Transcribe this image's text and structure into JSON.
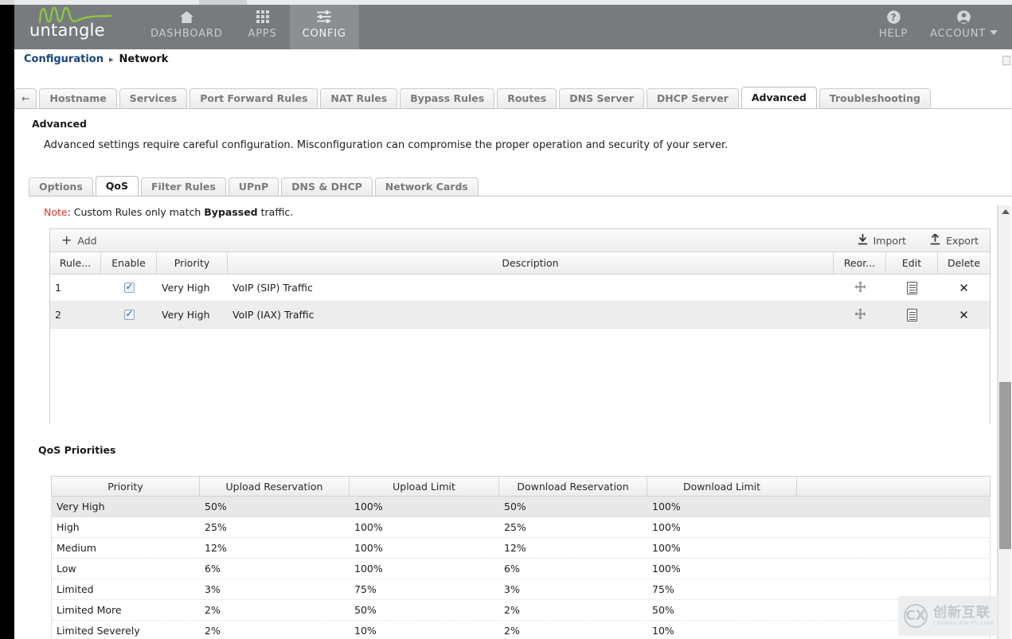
{
  "header": {
    "brand": "untangle",
    "nav": [
      {
        "label": "DASHBOARD",
        "icon": "home-icon",
        "active": false
      },
      {
        "label": "APPS",
        "icon": "grid-apps-icon",
        "active": false
      },
      {
        "label": "CONFIG",
        "icon": "sliders-icon",
        "active": true
      }
    ],
    "nav_right": [
      {
        "label": "HELP",
        "icon": "question-circle-icon"
      },
      {
        "label": "ACCOUNT",
        "icon": "user-circle-icon",
        "caret": "chevron-down-icon"
      }
    ]
  },
  "breadcrumb": {
    "root": "Configuration",
    "separator": "▸",
    "current": "Network"
  },
  "main_tabs": {
    "back_arrow": "←",
    "items": [
      {
        "label": "Hostname",
        "active": false
      },
      {
        "label": "Services",
        "active": false
      },
      {
        "label": "Port Forward Rules",
        "active": false
      },
      {
        "label": "NAT Rules",
        "active": false
      },
      {
        "label": "Bypass Rules",
        "active": false
      },
      {
        "label": "Routes",
        "active": false
      },
      {
        "label": "DNS Server",
        "active": false
      },
      {
        "label": "DHCP Server",
        "active": false
      },
      {
        "label": "Advanced",
        "active": true
      },
      {
        "label": "Troubleshooting",
        "active": false
      }
    ]
  },
  "section": {
    "title": "Advanced",
    "description": "Advanced settings require careful configuration. Misconfiguration can compromise the proper operation and security of your server."
  },
  "sub_tabs": {
    "items": [
      {
        "label": "Options",
        "active": false
      },
      {
        "label": "QoS",
        "active": true
      },
      {
        "label": "Filter Rules",
        "active": false
      },
      {
        "label": "UPnP",
        "active": false
      },
      {
        "label": "DNS & DHCP",
        "active": false
      },
      {
        "label": "Network Cards",
        "active": false
      }
    ]
  },
  "note": {
    "keyword": "Note",
    "text_before": ": Custom Rules only match ",
    "emphasis": "Bypassed",
    "text_after": " traffic."
  },
  "rules_grid": {
    "toolbar": {
      "add_label": "Add",
      "add_icon": "plus-icon",
      "import_label": "Import",
      "import_icon": "download-arrow-icon",
      "export_label": "Export",
      "export_icon": "upload-arrow-icon"
    },
    "columns": [
      "Rule...",
      "Enable",
      "Priority",
      "Description",
      "Reor...",
      "Edit",
      "Delete"
    ],
    "rows": [
      {
        "rule_id": "1",
        "enabled": true,
        "priority": "Very High",
        "description": "VoIP (SIP) Traffic",
        "reorder_icon": "move-handle-icon",
        "edit_icon": "document-edit-icon",
        "delete_icon": "close-x-icon"
      },
      {
        "rule_id": "2",
        "enabled": true,
        "priority": "Very High",
        "description": "VoIP (IAX) Traffic",
        "reorder_icon": "move-handle-icon",
        "edit_icon": "document-edit-icon",
        "delete_icon": "close-x-icon"
      }
    ]
  },
  "qos_priorities": {
    "title": "QoS Priorities",
    "columns": [
      "Priority",
      "Upload Reservation",
      "Upload Limit",
      "Download Reservation",
      "Download Limit"
    ],
    "rows": [
      {
        "priority": "Very High",
        "upload_reservation": "50%",
        "upload_limit": "100%",
        "download_reservation": "50%",
        "download_limit": "100%"
      },
      {
        "priority": "High",
        "upload_reservation": "25%",
        "upload_limit": "100%",
        "download_reservation": "25%",
        "download_limit": "100%"
      },
      {
        "priority": "Medium",
        "upload_reservation": "12%",
        "upload_limit": "100%",
        "download_reservation": "12%",
        "download_limit": "100%"
      },
      {
        "priority": "Low",
        "upload_reservation": "6%",
        "upload_limit": "100%",
        "download_reservation": "6%",
        "download_limit": "100%"
      },
      {
        "priority": "Limited",
        "upload_reservation": "3%",
        "upload_limit": "75%",
        "download_reservation": "3%",
        "download_limit": "75%"
      },
      {
        "priority": "Limited More",
        "upload_reservation": "2%",
        "upload_limit": "50%",
        "download_reservation": "2%",
        "download_limit": "50%"
      },
      {
        "priority": "Limited Severely",
        "upload_reservation": "2%",
        "upload_limit": "10%",
        "download_reservation": "2%",
        "download_limit": "10%"
      }
    ]
  },
  "watermark": {
    "zh": "创新互联",
    "en": "CHUANG XIN HU LIAN",
    "mark": "CX"
  },
  "colors": {
    "header_bg": "#777b7e",
    "header_active": "#8b8f92",
    "brand_green": "#8cc63f",
    "breadcrumb_link": "#17457f",
    "note_red": "#e03030",
    "row_alt": "#ededed"
  }
}
